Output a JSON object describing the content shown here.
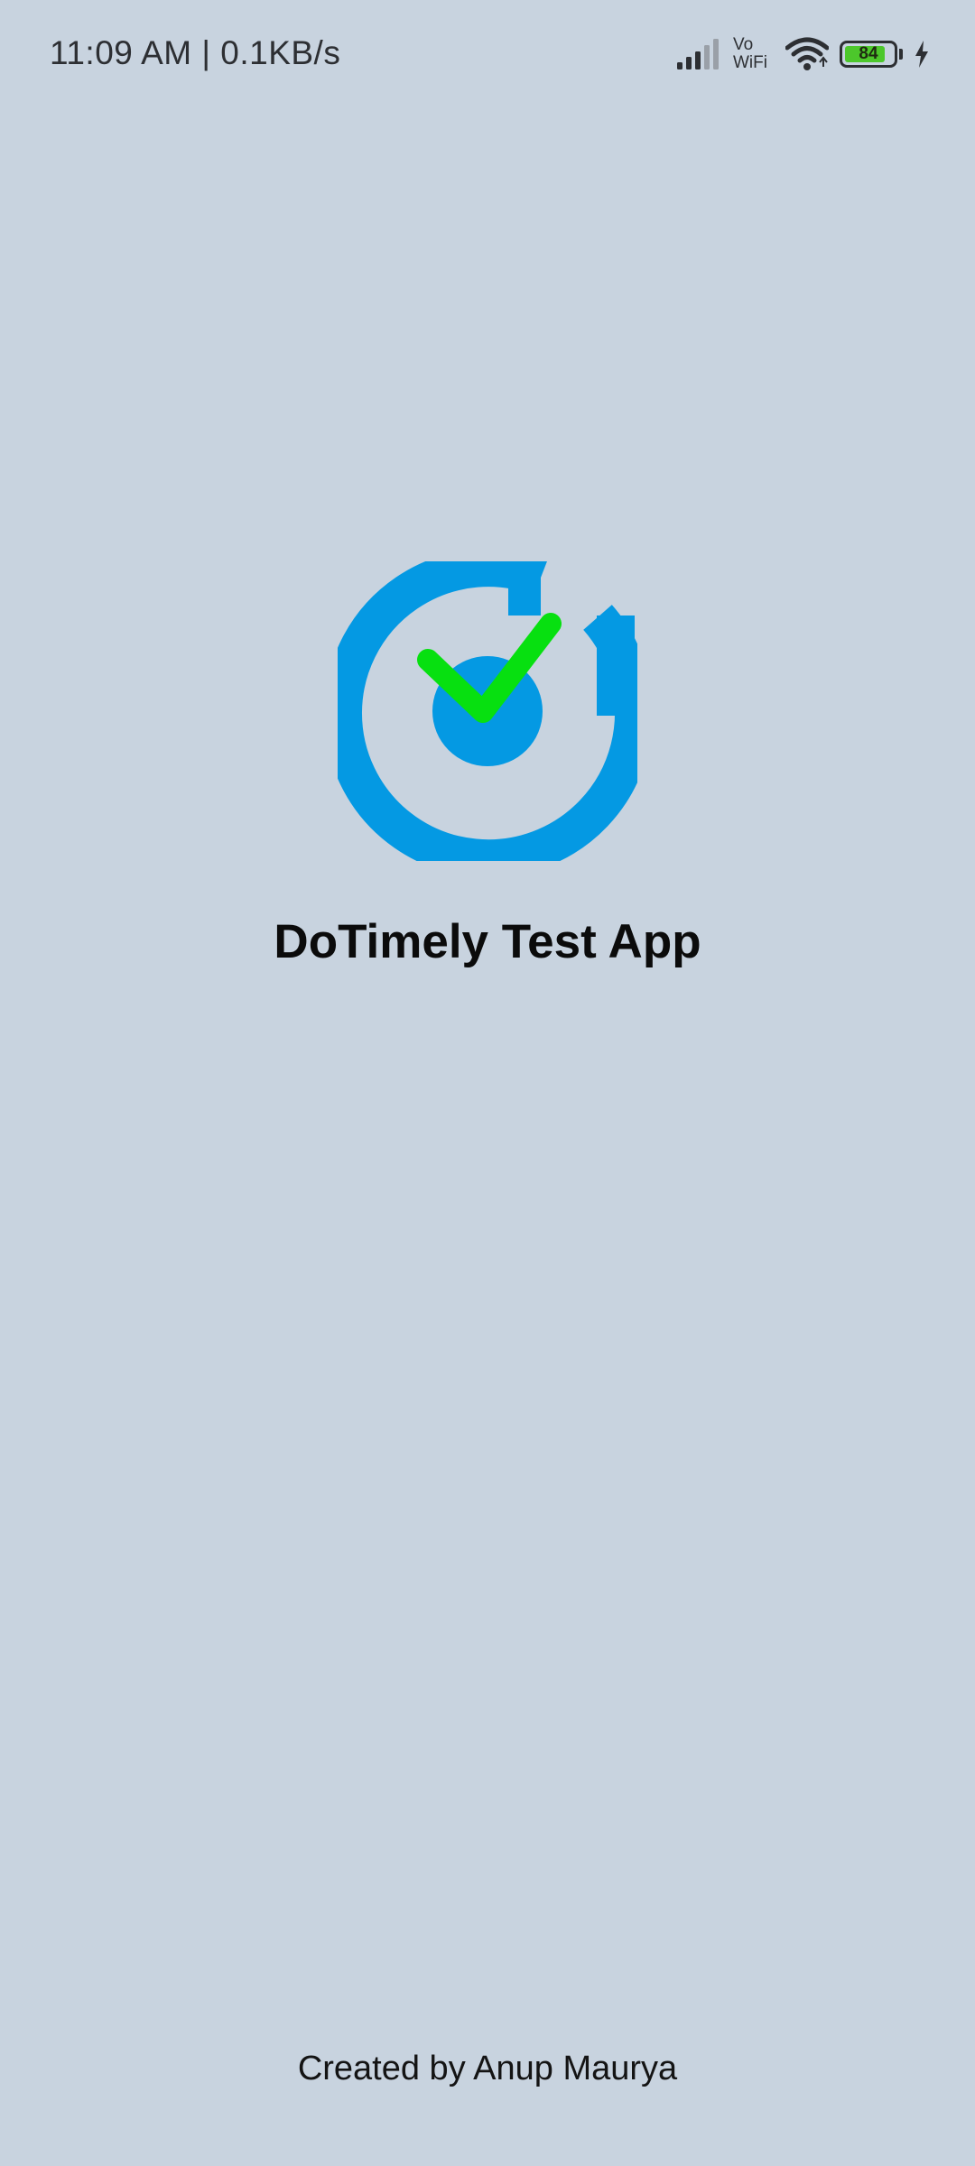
{
  "status_bar": {
    "time": "11:09 AM | 0.1KB/s",
    "vowifi_top": "Vo",
    "vowifi_bottom": "WiFi",
    "battery_level": "84",
    "battery_fraction": 0.84,
    "icons": [
      "signal-icon",
      "vowifi-icon",
      "wifi-icon",
      "battery-icon",
      "charging-icon"
    ]
  },
  "splash": {
    "logo_icon": "dotimely-logo-icon",
    "title": "DoTimely Test App",
    "credit": "Created by Anup Maurya"
  },
  "colors": {
    "background": "#c8d3df",
    "logo_blue": "#0499e3",
    "check_green": "#07e010",
    "battery_green": "#4cc72b"
  }
}
